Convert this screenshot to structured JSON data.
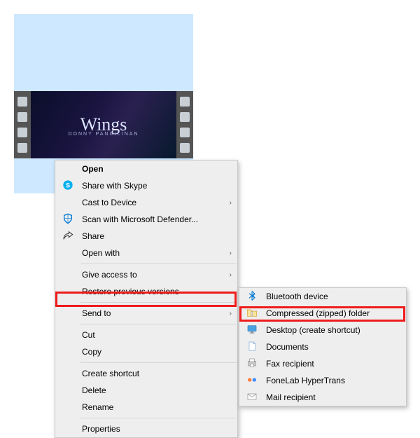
{
  "videoTitle": "Wings",
  "videoSubtitle": "DONNY PANGILINAN",
  "contextMenu": {
    "open": "Open",
    "shareSkype": "Share with Skype",
    "castToDevice": "Cast to Device",
    "scanDefender": "Scan with Microsoft Defender...",
    "share": "Share",
    "openWith": "Open with",
    "giveAccess": "Give access to",
    "restorePrev": "Restore previous versions",
    "sendTo": "Send to",
    "cut": "Cut",
    "copy": "Copy",
    "createShortcut": "Create shortcut",
    "delete": "Delete",
    "rename": "Rename",
    "properties": "Properties"
  },
  "sendToMenu": {
    "bluetooth": "Bluetooth device",
    "compressed": "Compressed (zipped) folder",
    "desktop": "Desktop (create shortcut)",
    "documents": "Documents",
    "fax": "Fax recipient",
    "fonelab": "FoneLab HyperTrans",
    "mail": "Mail recipient"
  }
}
